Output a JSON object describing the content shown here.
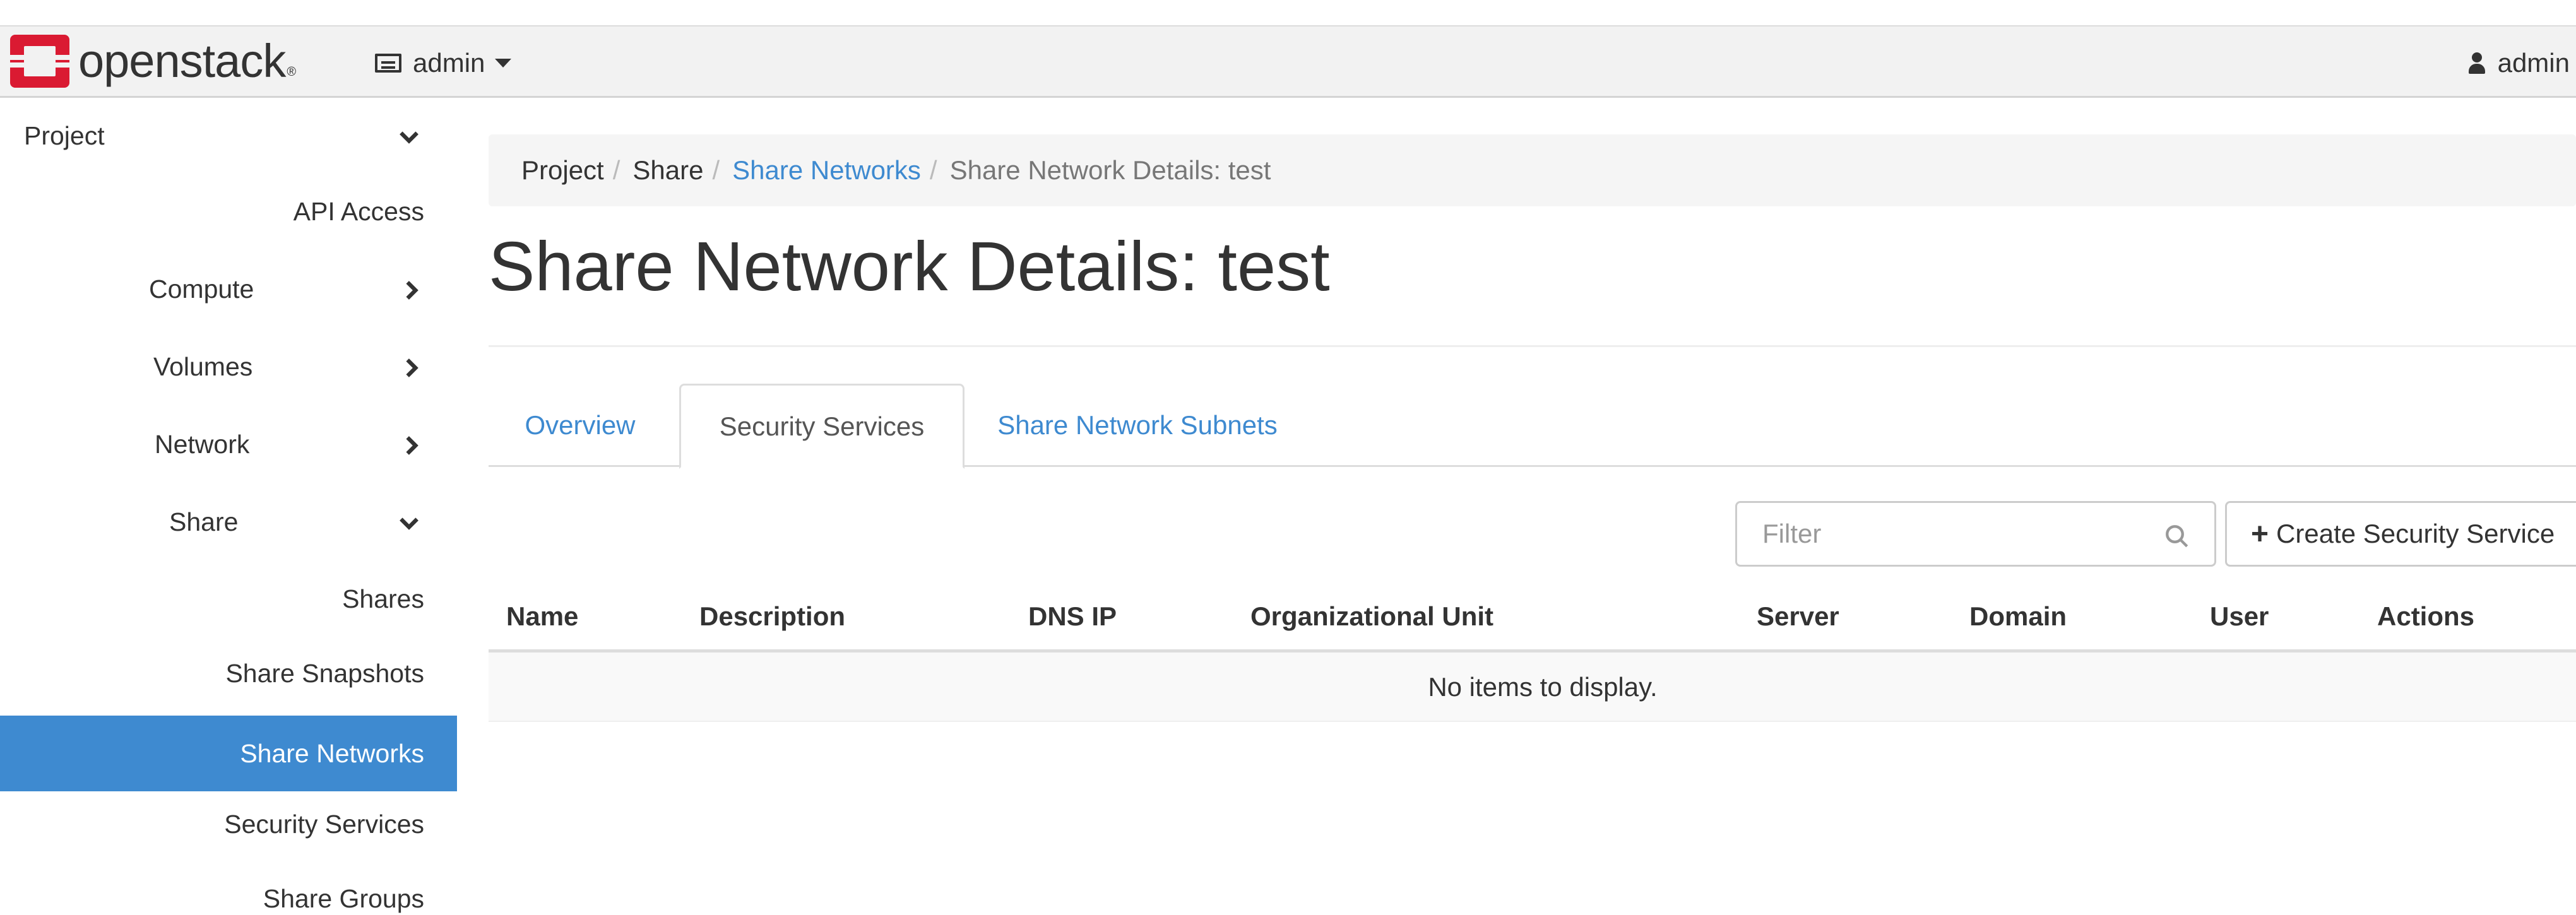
{
  "navbar": {
    "brand": "openstack",
    "project_selector": "admin",
    "user_menu": "admin"
  },
  "sidebar": {
    "items": [
      {
        "label": "Project"
      },
      {
        "label": "API Access"
      },
      {
        "label": "Compute"
      },
      {
        "label": "Volumes"
      },
      {
        "label": "Network"
      },
      {
        "label": "Share"
      },
      {
        "label": "Shares"
      },
      {
        "label": "Share Snapshots"
      },
      {
        "label": "Share Networks"
      },
      {
        "label": "Security Services"
      },
      {
        "label": "Share Groups"
      }
    ]
  },
  "breadcrumb": [
    "Project",
    "Share",
    "Share Networks",
    "Share Network Details: test"
  ],
  "page": {
    "title": "Share Network Details: test"
  },
  "tabs": [
    "Overview",
    "Security Services",
    "Share Network Subnets"
  ],
  "toolbar": {
    "filter_placeholder": "Filter",
    "create_button": "Create Security Service"
  },
  "table": {
    "columns": [
      "Name",
      "Description",
      "DNS IP",
      "Organizational Unit",
      "Server",
      "Domain",
      "User",
      "Actions"
    ],
    "empty_message": "No items to display."
  },
  "colors": {
    "accent": "#3e8ad0",
    "brand_red": "#da1a32"
  }
}
